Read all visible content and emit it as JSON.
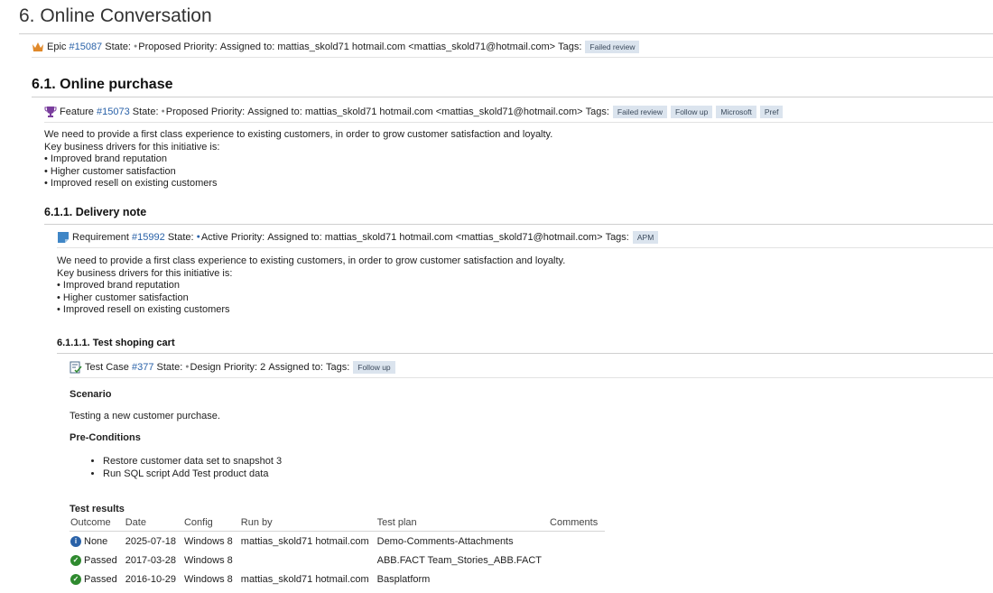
{
  "title": "6. Online Conversation",
  "epic": {
    "type": "Epic",
    "id": "#15087",
    "state_label": "State:",
    "state": "Proposed",
    "priority_label": "Priority:",
    "priority": "",
    "assigned_label": "Assigned to:",
    "assigned": "mattias_skold71 hotmail.com <mattias_skold71@hotmail.com>",
    "tags_label": "Tags:",
    "tags": [
      "Failed review"
    ],
    "icon": "crown-icon"
  },
  "section": {
    "title": "6.1. Online purchase",
    "feature": {
      "type": "Feature",
      "id": "#15073",
      "state_label": "State:",
      "state": "Proposed",
      "priority_label": "Priority:",
      "priority": "",
      "assigned_label": "Assigned to:",
      "assigned": "mattias_skold71 hotmail.com <mattias_skold71@hotmail.com>",
      "tags_label": "Tags:",
      "tags": [
        "Failed review",
        "Follow up",
        "Microsoft",
        "Pref"
      ],
      "icon": "trophy-icon"
    },
    "description": [
      "We need to provide a first class experience to existing customers, in order to grow customer satisfaction and loyalty.",
      "Key business drivers for this initiative is:",
      "• Improved brand reputation",
      "• Higher customer satisfaction",
      "• Improved resell on existing customers"
    ],
    "subsection": {
      "title": "6.1.1. Delivery note",
      "requirement": {
        "type": "Requirement",
        "id": "#15992",
        "state_label": "State:",
        "state": "Active",
        "priority_label": "Priority:",
        "priority": "",
        "assigned_label": "Assigned to:",
        "assigned": "mattias_skold71 hotmail.com <mattias_skold71@hotmail.com>",
        "tags_label": "Tags:",
        "tags": [
          "APM"
        ],
        "icon": "requirement-icon"
      },
      "description": [
        "We need to provide a first class experience to existing customers, in order to grow customer satisfaction and loyalty.",
        "Key business drivers for this initiative is:",
        "• Improved brand reputation",
        "• Higher customer satisfaction",
        "• Improved resell on existing customers"
      ],
      "testcase_section": {
        "title": "6.1.1.1. Test shoping cart",
        "testcase": {
          "type": "Test Case",
          "id": "#377",
          "state_label": "State:",
          "state": "Design",
          "priority_label": "Priority:",
          "priority": "2",
          "assigned_label": "Assigned to:",
          "assigned": "",
          "tags_label": "Tags:",
          "tags": [
            "Follow up"
          ],
          "icon": "test-case-icon"
        },
        "scenario_heading": "Scenario",
        "scenario_text": "Testing a new customer purchase.",
        "preconditions_heading": "Pre-Conditions",
        "preconditions": [
          "Restore customer data set to snapshot 3",
          "Run SQL script  Add Test product data"
        ],
        "results_heading": "Test results",
        "columns": [
          "Outcome",
          "Date",
          "Config",
          "Run by",
          "Test plan",
          "Comments"
        ],
        "rows": [
          {
            "outcome": "None",
            "status": "none",
            "date": "2025-07-18",
            "config": "Windows 8",
            "run_by": "mattias_skold71 hotmail.com",
            "plan": "Demo-Comments-Attachments",
            "comments": ""
          },
          {
            "outcome": "Passed",
            "status": "passed",
            "date": "2017-03-28",
            "config": "Windows 8",
            "run_by": "",
            "plan": "ABB.FACT Team_Stories_ABB.FACT",
            "comments": ""
          },
          {
            "outcome": "Passed",
            "status": "passed",
            "date": "2016-10-29",
            "config": "Windows 8",
            "run_by": "mattias_skold71 hotmail.com",
            "plan": "Basplatform",
            "comments": ""
          }
        ]
      }
    }
  },
  "colors": {
    "link": "#2a62a8",
    "tag_bg": "#dbe4ee",
    "passed": "#2f8a2f",
    "none": "#2a62a8"
  }
}
